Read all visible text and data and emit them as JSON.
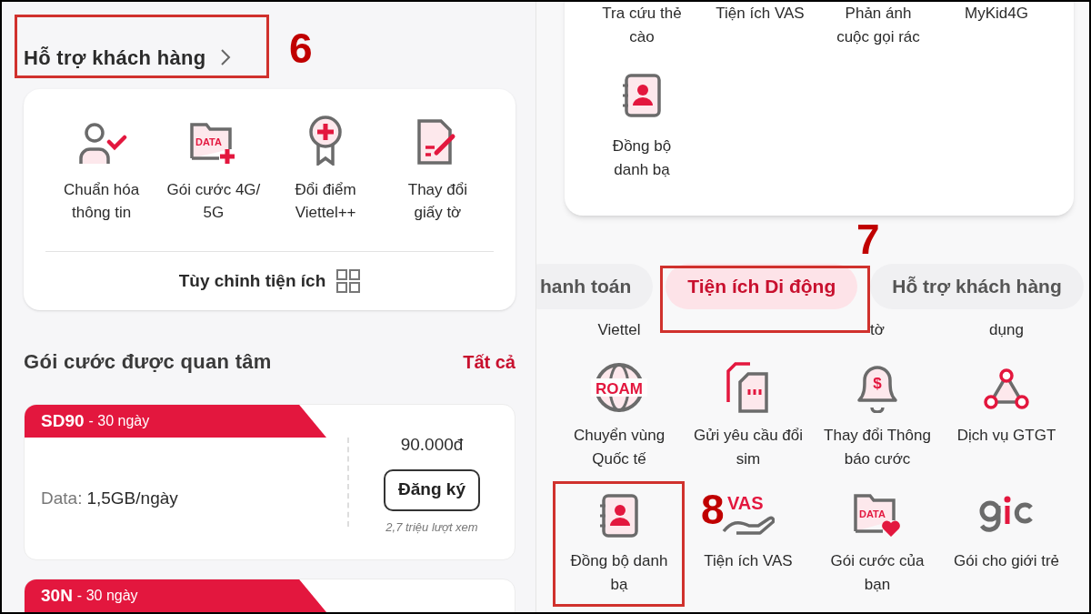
{
  "left": {
    "section_title": "Hỗ trợ khách hàng",
    "shortcuts": [
      {
        "label": "Chuẩn hóa thông tin"
      },
      {
        "label": "Gói cước 4G/ 5G",
        "icon_text": "DATA"
      },
      {
        "label": "Đổi điểm Viettel++"
      },
      {
        "label": "Thay đổi giấy tờ"
      }
    ],
    "customize": "Tùy chỉnh tiện ích",
    "packages_title": "Gói cước được quan tâm",
    "see_all": "Tất cả",
    "packages": [
      {
        "name": "SD90",
        "duration": "- 30 ngày",
        "data_label": "Data:",
        "data_value": "1,5GB/ngày",
        "price": "90.000đ",
        "button": "Đăng ký",
        "views": "2,7 triệu lượt xem"
      },
      {
        "name": "30N",
        "duration": "- 30 ngày"
      }
    ]
  },
  "right": {
    "top_labels": [
      "Tra cứu thẻ cào",
      "Tiện ích VAS",
      "Phản ánh cuộc gọi rác",
      "MyKid4G"
    ],
    "card_items": [
      {
        "label": "Đồng bộ danh bạ"
      }
    ],
    "tabs": [
      {
        "label": "hanh toán",
        "selected": false
      },
      {
        "label": "Tiện ích Di động",
        "selected": true
      },
      {
        "label": "Hỗ trợ khách hàng",
        "selected": false
      }
    ],
    "partial_labels": [
      "Viettel",
      "tờ",
      "dụng"
    ],
    "grid": [
      {
        "label": "Chuyển vùng Quốc tế",
        "icon_text": "ROAM"
      },
      {
        "label": "Gửi yêu cầu đổi sim"
      },
      {
        "label": "Thay đổi Thông báo cước",
        "icon_text": "$"
      },
      {
        "label": "Dịch vụ GTGT"
      },
      {
        "label": "Đồng bộ danh bạ"
      },
      {
        "label": "Tiện ích VAS",
        "icon_text": "VAS"
      },
      {
        "label": "Gói cước của bạn",
        "icon_text": "DATA"
      },
      {
        "label": "Gói cho giới trẻ"
      }
    ]
  },
  "annotations": [
    "6",
    "7",
    "8"
  ]
}
